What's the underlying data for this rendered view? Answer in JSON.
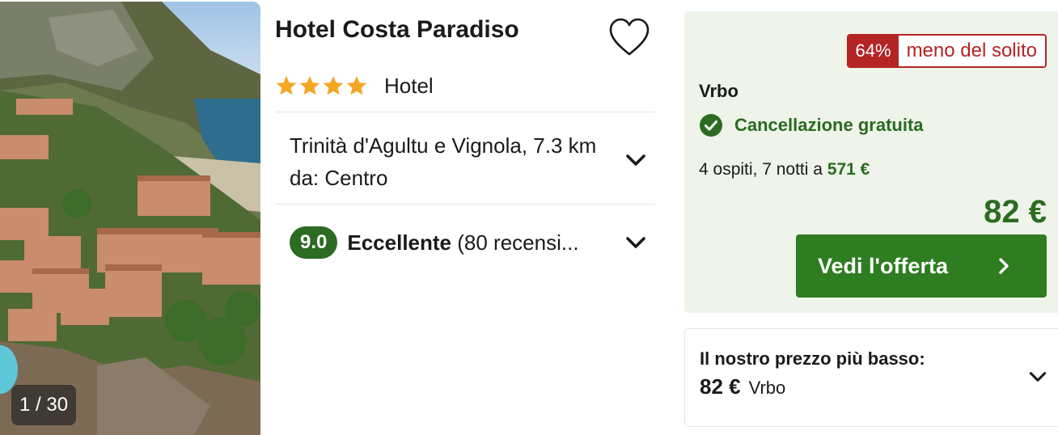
{
  "photo": {
    "counter": "1 / 30"
  },
  "hotel": {
    "name": "Hotel Costa Paradiso",
    "stars": 4,
    "type": "Hotel",
    "location": "Trinità d'Agultu e Vignola, 7.3 km da: Centro",
    "score": "9.0",
    "rating_word": "Eccellente",
    "reviews_text": "(80 recensi..."
  },
  "offer": {
    "discount_pct": "64%",
    "discount_text": "meno del solito",
    "provider": "Vrbo",
    "cancellation": "Cancellazione gratuita",
    "stay_prefix": "4 ospiti, 7 notti a ",
    "stay_total": "571 €",
    "price": "82 €",
    "cta_label": "Vedi l'offerta"
  },
  "lowest": {
    "label": "Il nostro prezzo più basso:",
    "price": "82 €",
    "provider": "Vrbo"
  },
  "colors": {
    "green": "#2b6b22",
    "cta_green": "#2e7d21",
    "offer_bg": "#eef4e9",
    "badge_red": "#b42424",
    "star": "#f5a623"
  },
  "icons": [
    "heart-icon",
    "star-icon",
    "chevron-down-icon",
    "check-circle-icon",
    "chevron-right-icon"
  ]
}
